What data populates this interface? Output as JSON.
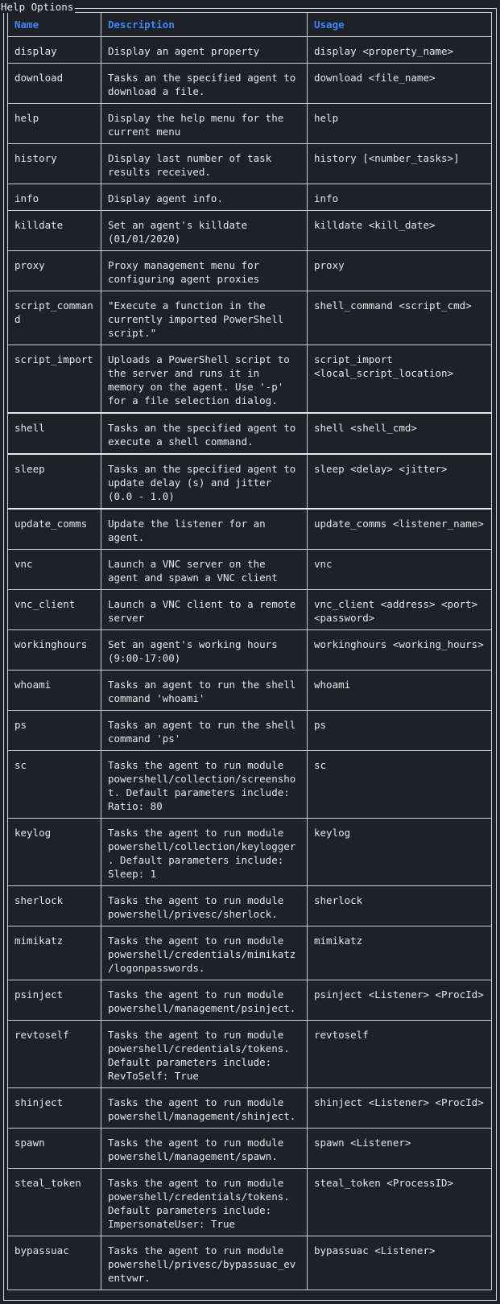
{
  "panel": {
    "title": "Help Options"
  },
  "table": {
    "headers": [
      "Name",
      "Description",
      "Usage"
    ],
    "rows": [
      {
        "name": "display",
        "description": "Display an agent property",
        "usage": "display <property_name>"
      },
      {
        "name": "download",
        "description": "Tasks an the specified agent to download a file.",
        "usage": "download <file_name>"
      },
      {
        "name": "help",
        "description": "Display the help menu for the current menu",
        "usage": "help"
      },
      {
        "name": "history",
        "description": "Display last number of task results received.",
        "usage": "history [<number_tasks>]"
      },
      {
        "name": "info",
        "description": "Display agent info.",
        "usage": "info"
      },
      {
        "name": "killdate",
        "description": "Set an agent's killdate (01/01/2020)",
        "usage": "killdate <kill_date>"
      },
      {
        "name": "proxy",
        "description": "Proxy management menu for configuring agent proxies",
        "usage": "proxy"
      },
      {
        "name": "script_command",
        "description": "\"Execute a function in the currently imported PowerShell script.\"",
        "usage": "shell_command <script_cmd>"
      },
      {
        "name": "script_import",
        "description": "Uploads a PowerShell script to the server and runs it in memory on the agent. Use '-p' for a file selection dialog.",
        "usage": "script_import <local_script_location>"
      },
      {
        "name": "shell",
        "description": "Tasks an the specified agent to execute a shell command.",
        "usage": "shell <shell_cmd>"
      },
      {
        "name": "sleep",
        "description": "Tasks an the specified agent to update delay (s) and jitter (0.0 - 1.0)",
        "usage": "sleep <delay> <jitter>"
      },
      {
        "name": "update_comms",
        "description": "Update the listener for an agent.",
        "usage": "update_comms <listener_name>"
      },
      {
        "name": "vnc",
        "description": "Launch a VNC server on the agent and spawn a VNC client",
        "usage": "vnc"
      },
      {
        "name": "vnc_client",
        "description": "Launch a VNC client to a remote server",
        "usage": "vnc_client <address> <port> <password>"
      },
      {
        "name": "workinghours",
        "description": "Set an agent's working hours (9:00-17:00)",
        "usage": "workinghours <working_hours>"
      },
      {
        "name": "whoami",
        "description": "Tasks an agent to run the shell command 'whoami'",
        "usage": "whoami"
      },
      {
        "name": "ps",
        "description": "Tasks an agent to run the shell command 'ps'",
        "usage": "ps"
      },
      {
        "name": "sc",
        "description": "Tasks the agent to run module powershell/collection/screenshot. Default parameters include: Ratio: 80",
        "usage": "sc"
      },
      {
        "name": "keylog",
        "description": "Tasks the agent to run module powershell/collection/keylogger. Default parameters include: Sleep: 1",
        "usage": "keylog"
      },
      {
        "name": "sherlock",
        "description": "Tasks the agent to run module powershell/privesc/sherlock.",
        "usage": "sherlock"
      },
      {
        "name": "mimikatz",
        "description": "Tasks the agent to run module powershell/credentials/mimikatz/logonpasswords.",
        "usage": "mimikatz"
      },
      {
        "name": "psinject",
        "description": "Tasks the agent to run module powershell/management/psinject.",
        "usage": "psinject <Listener> <ProcId>"
      },
      {
        "name": "revtoself",
        "description": "Tasks the agent to run module powershell/credentials/tokens. Default parameters include: RevToSelf: True",
        "usage": "revtoself"
      },
      {
        "name": "shinject",
        "description": "Tasks the agent to run module powershell/management/shinject.",
        "usage": "shinject <Listener> <ProcId>"
      },
      {
        "name": "spawn",
        "description": "Tasks the agent to run module powershell/management/spawn.",
        "usage": "spawn <Listener>"
      },
      {
        "name": "steal_token",
        "description": "Tasks the agent to run module powershell/credentials/tokens. Default parameters include: ImpersonateUser: True",
        "usage": "steal_token <ProcessID>"
      },
      {
        "name": "bypassuac",
        "description": "Tasks the agent to run module powershell/privesc/bypassuac_eventvwr.",
        "usage": "bypassuac <Listener>"
      }
    ]
  },
  "colors": {
    "background": "#1f2129",
    "header_text": "#3f87f5",
    "border": "#cfcfcf",
    "text": "#e6e6e6"
  }
}
